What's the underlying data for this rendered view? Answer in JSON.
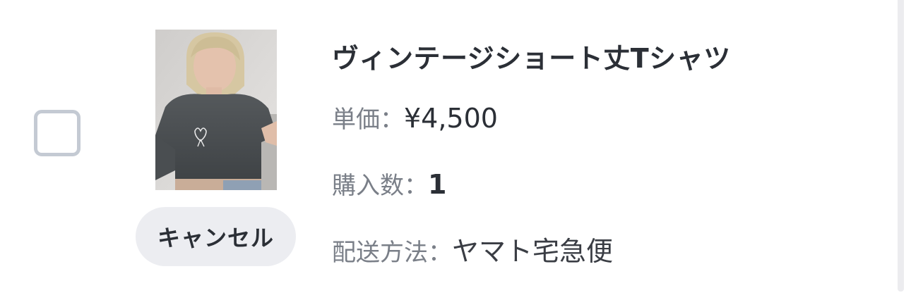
{
  "item": {
    "title": "ヴィンテージショート丈Tシャツ",
    "price_label": "単価：",
    "price_value": "¥4,500",
    "quantity_label": "購入数：",
    "quantity_value": "1",
    "shipping_label": "配送方法：",
    "shipping_value": "ヤマト宅急便",
    "cancel_label": "キャンセル",
    "checked": false,
    "image_alt": "product-photo"
  },
  "colors": {
    "text_primary": "#2b2f36",
    "text_label": "#7a7f88",
    "checkbox_border": "#c4cad3",
    "button_bg": "#ecedf1"
  }
}
